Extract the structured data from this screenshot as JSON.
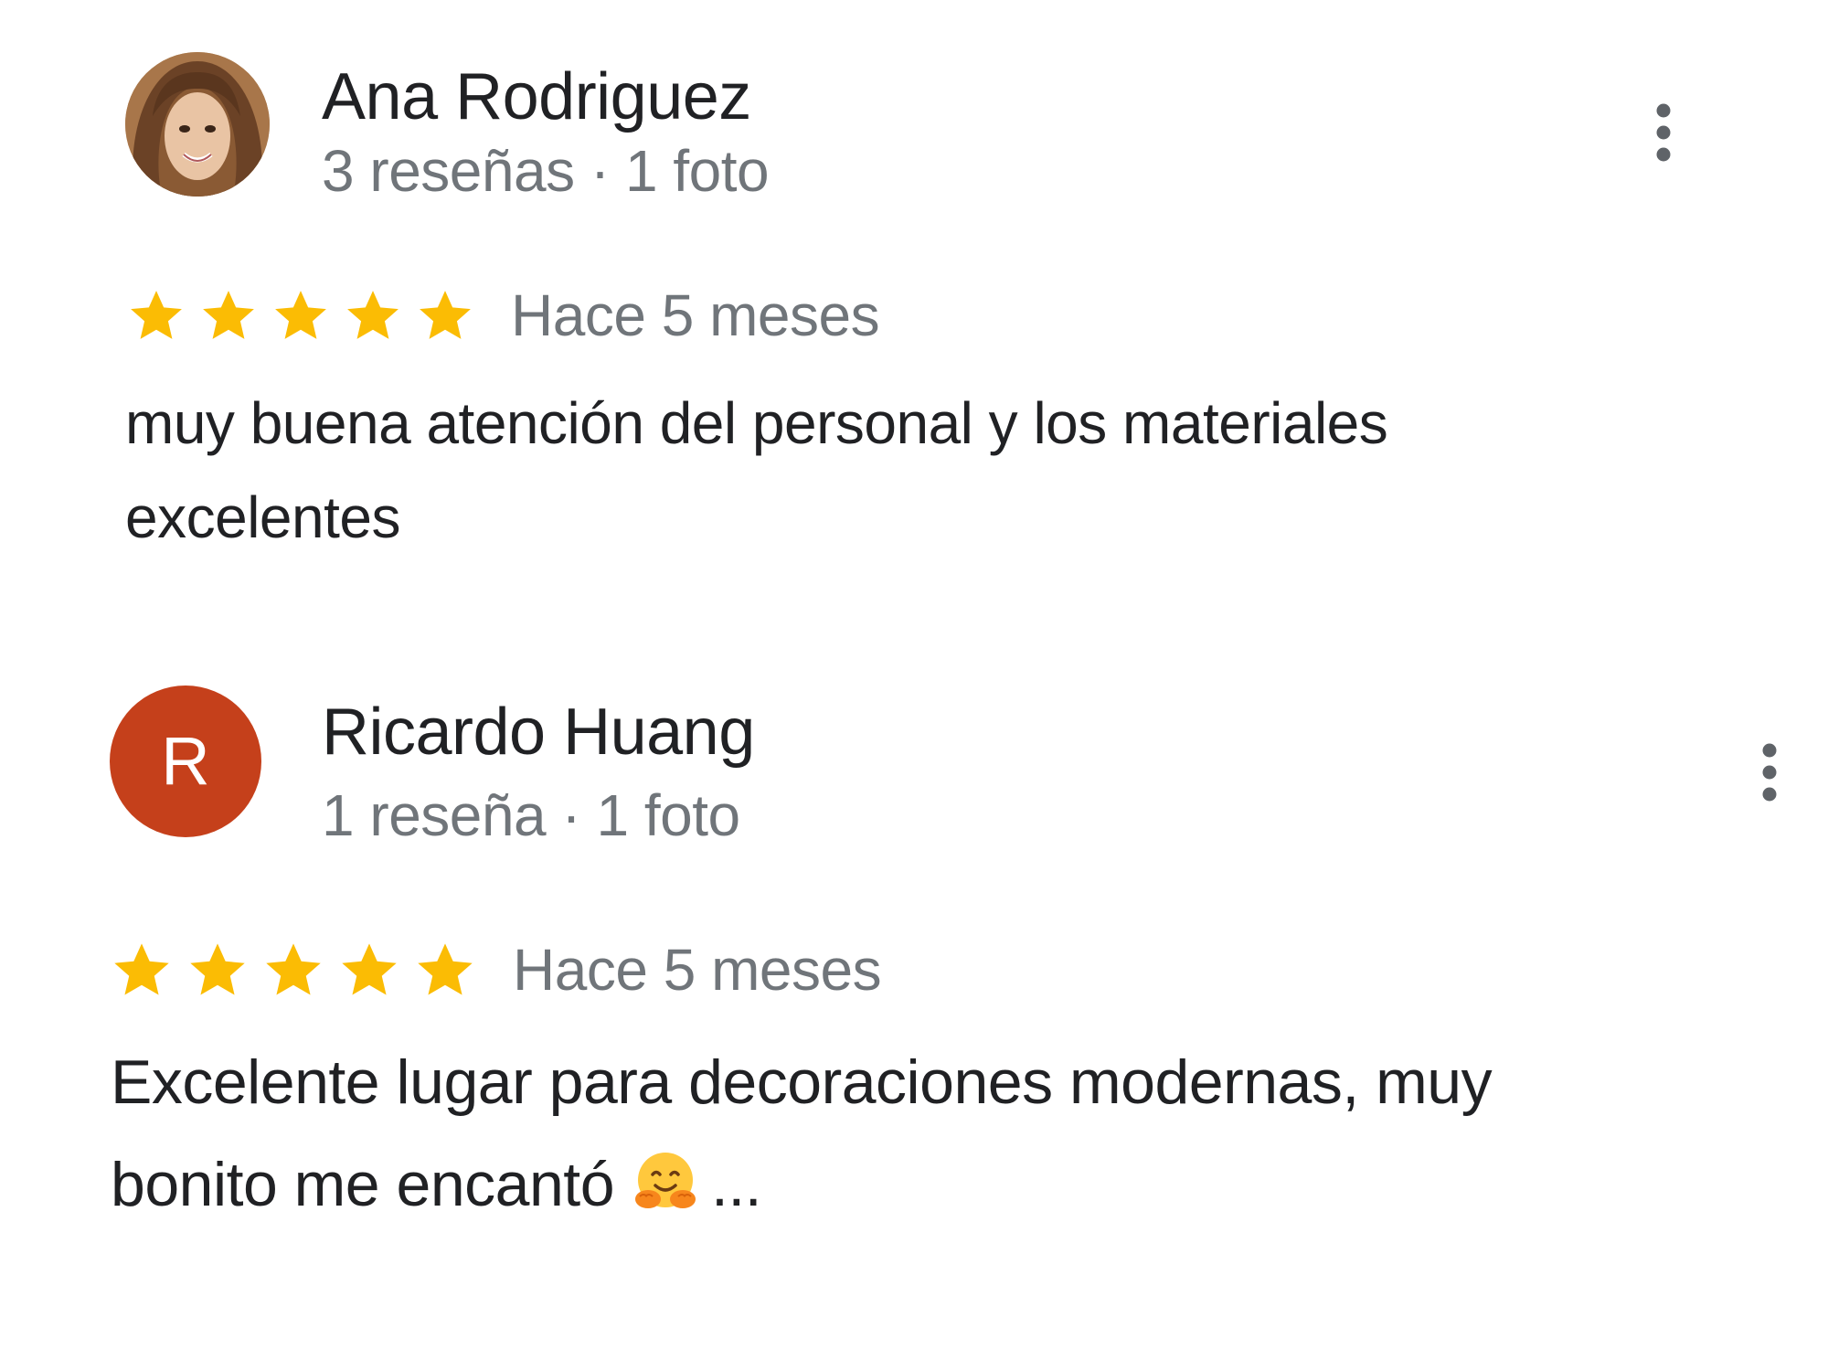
{
  "reviews": [
    {
      "author": "Ana Rodriguez",
      "meta": "3 reseñas · 1 foto",
      "avatar_type": "photo",
      "rating": 5,
      "rating_max": 5,
      "date": "Hace 5 meses",
      "text_lines": [
        "muy buena atención del personal y los materiales",
        "excelentes"
      ]
    },
    {
      "author": "Ricardo Huang",
      "meta": "1 reseña · 1 foto",
      "avatar_type": "letter",
      "avatar_letter": "R",
      "avatar_color": "#c5401b",
      "rating": 5,
      "rating_max": 5,
      "date": "Hace 5 meses",
      "text_lines": [
        "Excelente lugar para decoraciones modernas, muy",
        "bonito me encantó"
      ],
      "text_emoji": "hugging-face-emoji",
      "text_ellipsis": "..."
    }
  ],
  "colors": {
    "star": "#fbbc04",
    "name": "#202124",
    "secondary": "#70757a",
    "menu_dots": "#5f6368"
  },
  "icons": {
    "menu": "more-vert-icon",
    "star": "star-icon"
  }
}
